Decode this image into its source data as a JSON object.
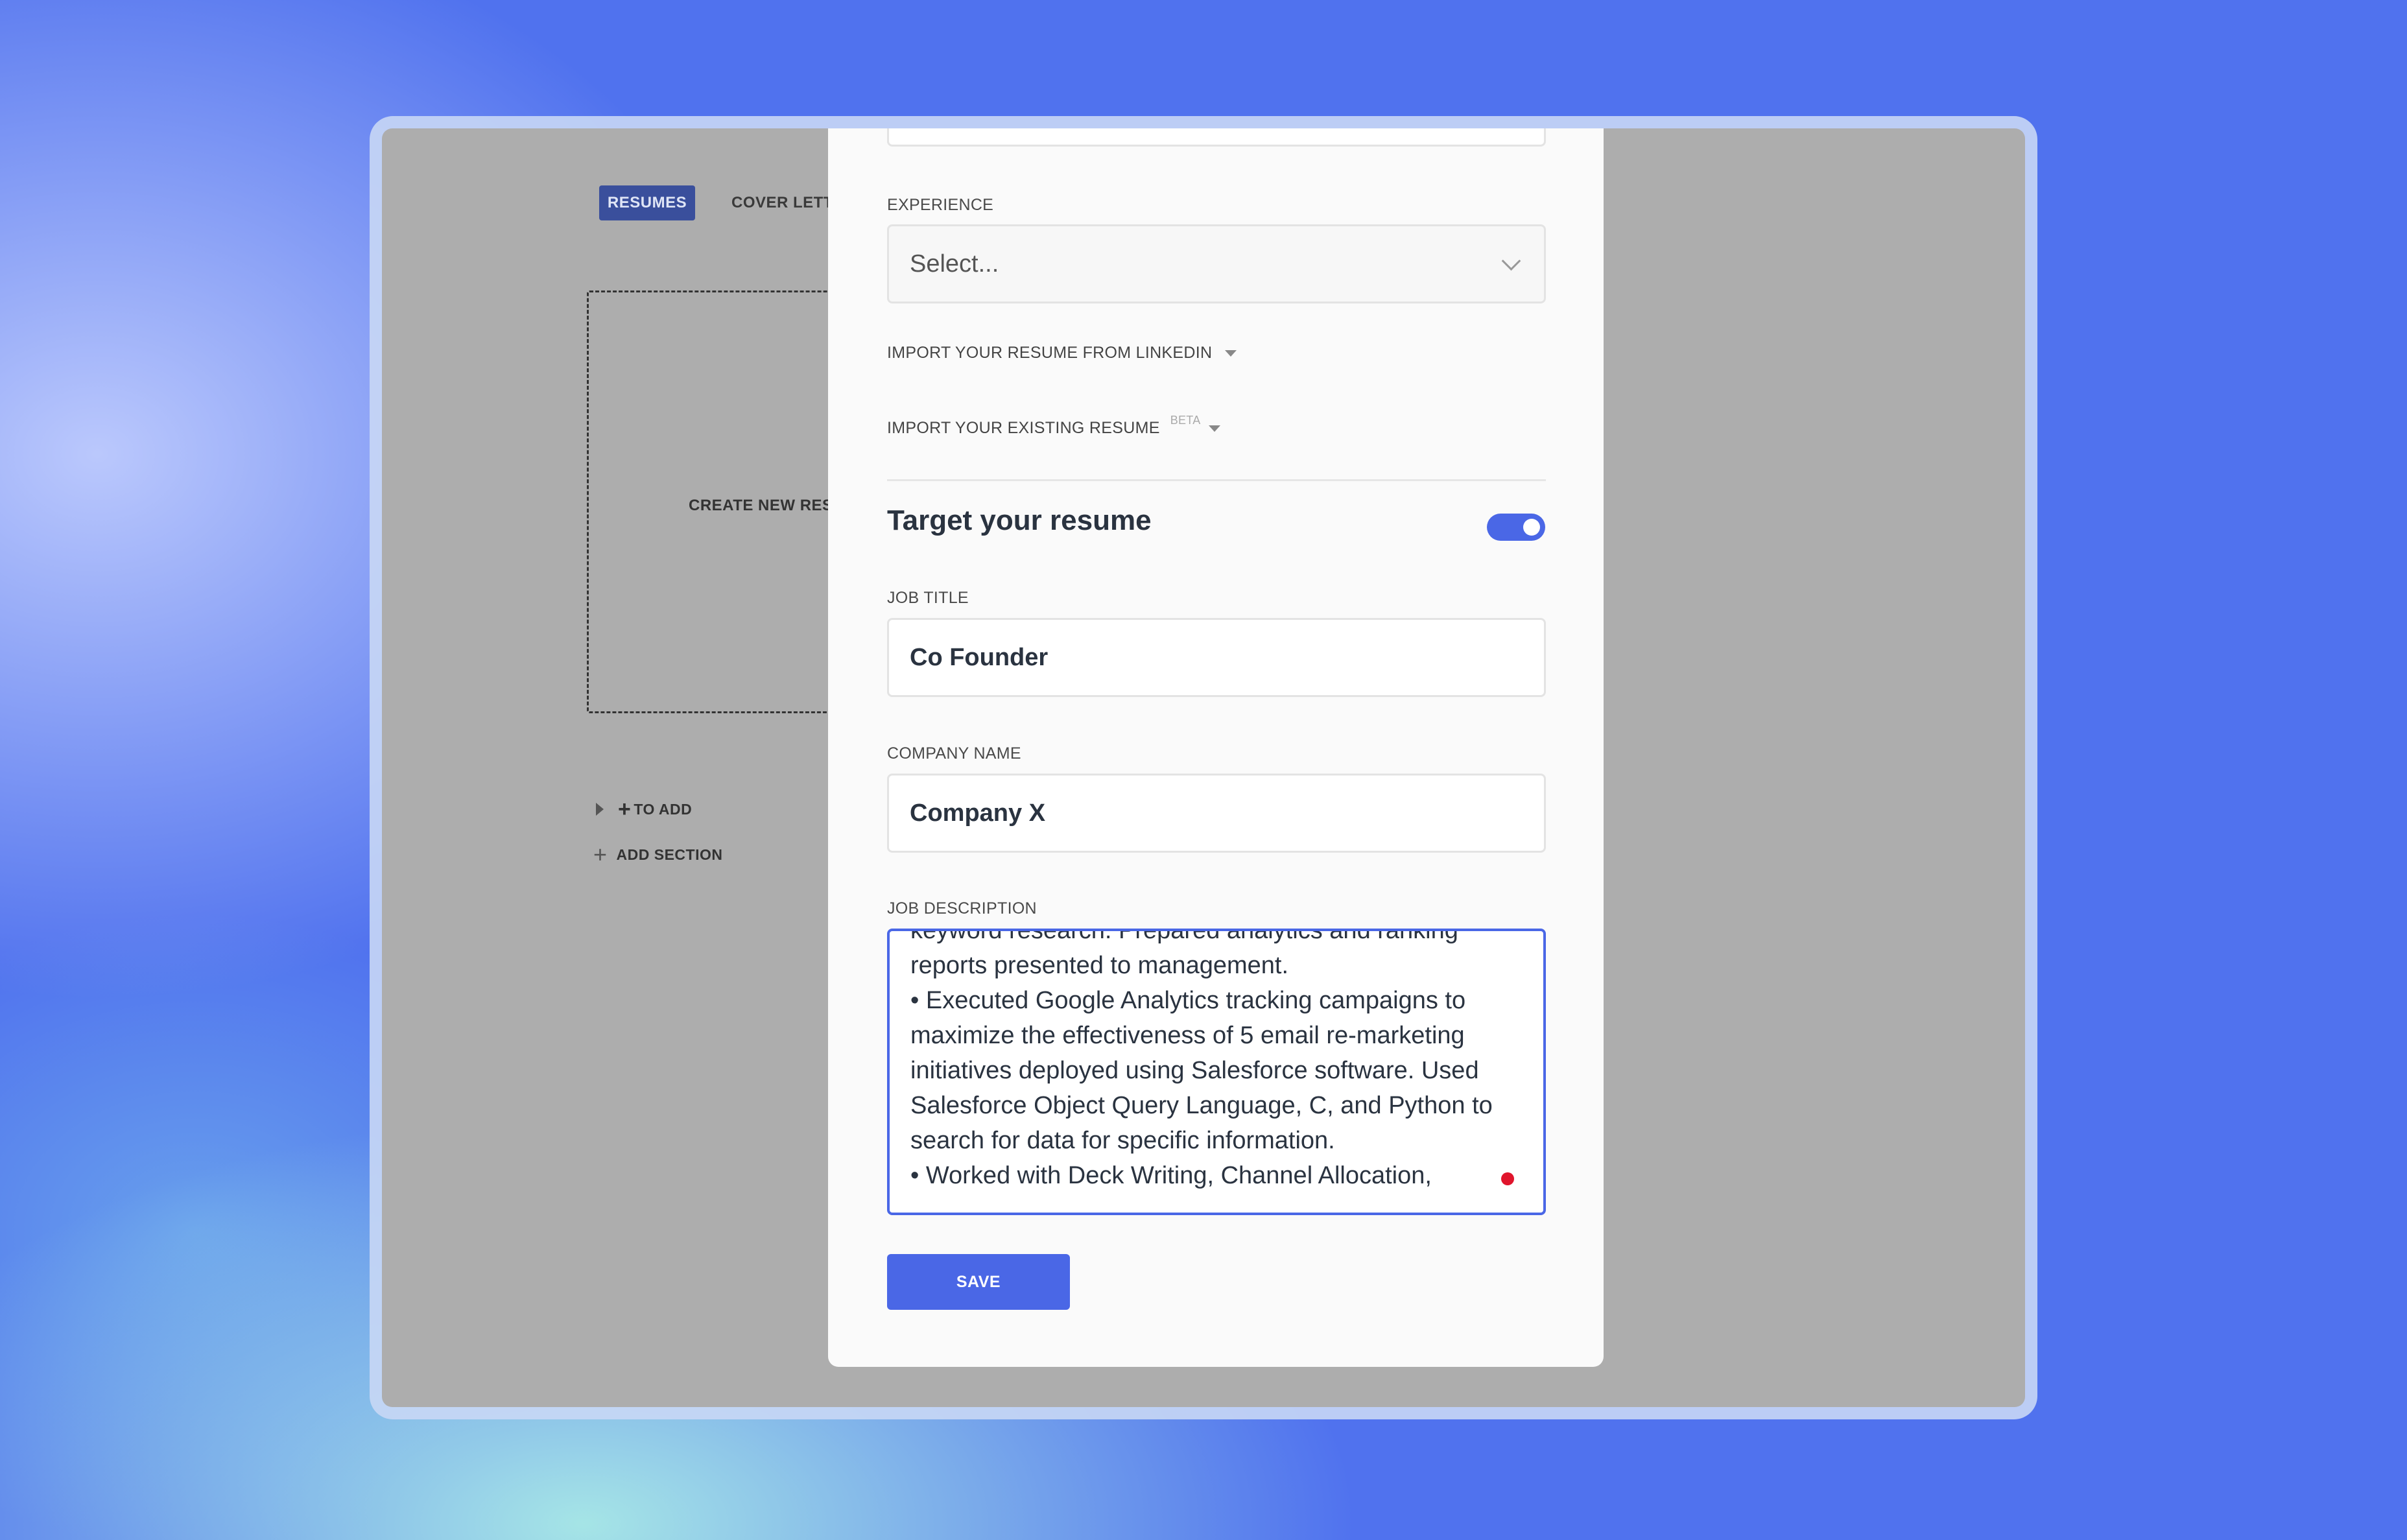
{
  "app": {
    "tabs": [
      {
        "label": "RESUMES",
        "active": true
      },
      {
        "label": "COVER LETT",
        "active": false
      }
    ],
    "create_card_label": "CREATE NEW RES",
    "to_add_label": "TO ADD",
    "add_section_label": "ADD SECTION"
  },
  "modal": {
    "experience": {
      "label": "EXPERIENCE",
      "placeholder": "Select..."
    },
    "import_linkedin_label": "IMPORT YOUR RESUME FROM LINKEDIN",
    "import_existing_label": "IMPORT YOUR EXISTING RESUME",
    "import_existing_badge": "BETA",
    "target_section": {
      "title": "Target your resume",
      "toggle_on": true
    },
    "job_title": {
      "label": "JOB TITLE",
      "value": "Co Founder"
    },
    "company_name": {
      "label": "COMPANY NAME",
      "value": "Company X"
    },
    "job_description": {
      "label": "JOB DESCRIPTION",
      "lines": [
        "keyword research. Prepared analytics and ranking",
        "reports presented to management.",
        "• Executed Google Analytics tracking campaigns to",
        "maximize the effectiveness of 5 email re-marketing",
        "initiatives deployed using Salesforce software. Used",
        "Salesforce Object Query Language, C, and Python to",
        "search for data for specific information.",
        "• Worked with Deck Writing, Channel Allocation,"
      ]
    },
    "save_label": "SAVE"
  },
  "colors": {
    "accent": "#4a67e6",
    "error_dot": "#e0152c",
    "background": "#5072ee"
  }
}
